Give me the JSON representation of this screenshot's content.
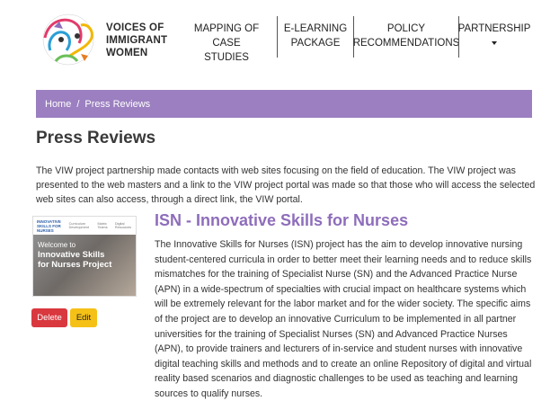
{
  "brand": {
    "line1": "VOICES OF",
    "line2": "IMMIGRANT",
    "line3": "WOMEN"
  },
  "nav": {
    "mapping": [
      "MAPPING OF CASE",
      "STUDIES"
    ],
    "elearning": [
      "E-LEARNING",
      "PACKAGE"
    ],
    "policy": [
      "POLICY",
      "RECOMMENDATIONS"
    ],
    "partnership": "PARTNERSHIP"
  },
  "breadcrumb": {
    "home": "Home",
    "separator": "/",
    "current": "Press Reviews"
  },
  "page": {
    "title": "Press Reviews",
    "intro": "The VIW project partnership made contacts with web sites focusing on the field of education. The VIW project was presented to the web masters and a link to the VIW project portal was made so that those who will access the selected web sites can also access, through a direct link, the VIW portal."
  },
  "item": {
    "title": "ISN - Innovative Skills for Nurses",
    "body": "The Innovative Skills for Nurses (ISN) project has the aim to develop innovative nursing student-centered curricula in order to better meet their learning needs and to reduce skills mismatches for the training of Specialist Nurse (SN) and the Advanced Practice Nurse (APN) in a wide-spectrum of specialties with crucial impact on healthcare systems which will be extremely relevant for the labor market and for the wider society. The specific aims of the project are to develop an innovative Curriculum to be implemented in all partner universities for the training of Specialist Nurses (SN) and Advanced Practice Nurses (APN), to provide trainers and lecturers of in-service and student nurses with innovative digital teaching skills and methods and to create an online Repository of digital and virtual reality based scenarios and diagnostic challenges to be used as teaching and learning sources to qualify nurses.",
    "delete_label": "Delete",
    "edit_label": "Edit",
    "thumbnail": {
      "logo_line1": "INNOVATIVE",
      "logo_line2": "SKILLS FOR NURSES",
      "menu": [
        "Curriculum Development",
        "Matrix Teams",
        "Digital Resources"
      ],
      "welcome_line1": "Welcome to",
      "welcome_line2": "Innovative Skills",
      "welcome_line3": "for Nurses Project"
    }
  },
  "colors": {
    "accent": "#9b7fc0",
    "item_title": "#8e6dbb",
    "delete": "#d9383f",
    "edit": "#f6c117"
  }
}
